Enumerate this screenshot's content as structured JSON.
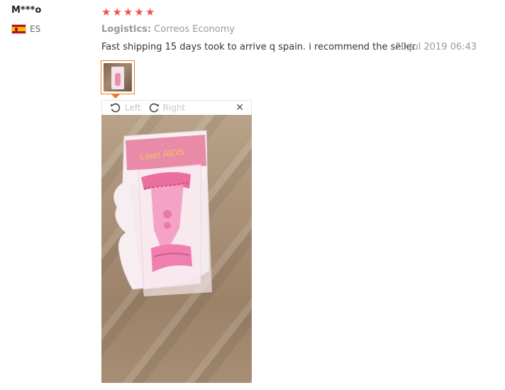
{
  "review": {
    "user_name": "M***o",
    "country_code": "ES",
    "rating": 5,
    "stars": [
      "★",
      "★",
      "★",
      "★",
      "★"
    ],
    "logistics_label": "Logistics:",
    "logistics_value": "Correos Economy",
    "text": "Fast shipping 15 days took to arrive q spain. i recommend the seller",
    "date": "20 Jul 2019 06:43"
  },
  "viewer": {
    "rotate_left_label": "Left",
    "rotate_right_label": "Right",
    "close_glyph": "✕",
    "package_label": "Liner AIDS"
  },
  "colors": {
    "star": "#f0514d",
    "thumb_border": "#f27a23",
    "muted": "#999999"
  }
}
